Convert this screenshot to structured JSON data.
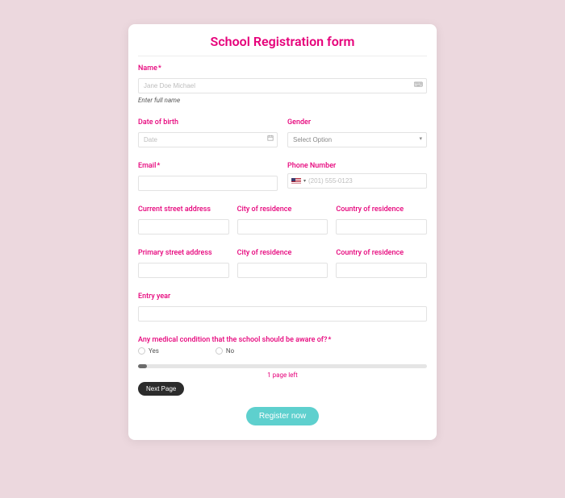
{
  "title": "School Registration form",
  "required_marker": "*",
  "fields": {
    "name": {
      "label": "Name",
      "placeholder": "Jane Doe Michael",
      "helper": "Enter full name"
    },
    "dob": {
      "label": "Date of birth",
      "placeholder": "Date"
    },
    "gender": {
      "label": "Gender",
      "selected": "Select Option"
    },
    "email": {
      "label": "Email"
    },
    "phone": {
      "label": "Phone Number",
      "placeholder": "(201) 555-0123"
    },
    "current_street": {
      "label": "Current street address"
    },
    "current_city": {
      "label": "City of residence"
    },
    "current_country": {
      "label": "Country of residence"
    },
    "primary_street": {
      "label": "Primary street address"
    },
    "primary_city": {
      "label": "City of residence"
    },
    "primary_country": {
      "label": "Country of residence"
    },
    "entry_year": {
      "label": "Entry year"
    },
    "medical": {
      "label": "Any medical condition that the school should be aware of?",
      "options": {
        "yes": "Yes",
        "no": "No"
      }
    }
  },
  "pagination": {
    "pages_left": "1 page left",
    "next_label": "Next Page"
  },
  "submit_label": "Register now",
  "icons": {
    "keyboard": "⌨",
    "calendar": "📅",
    "caret": "▾"
  }
}
